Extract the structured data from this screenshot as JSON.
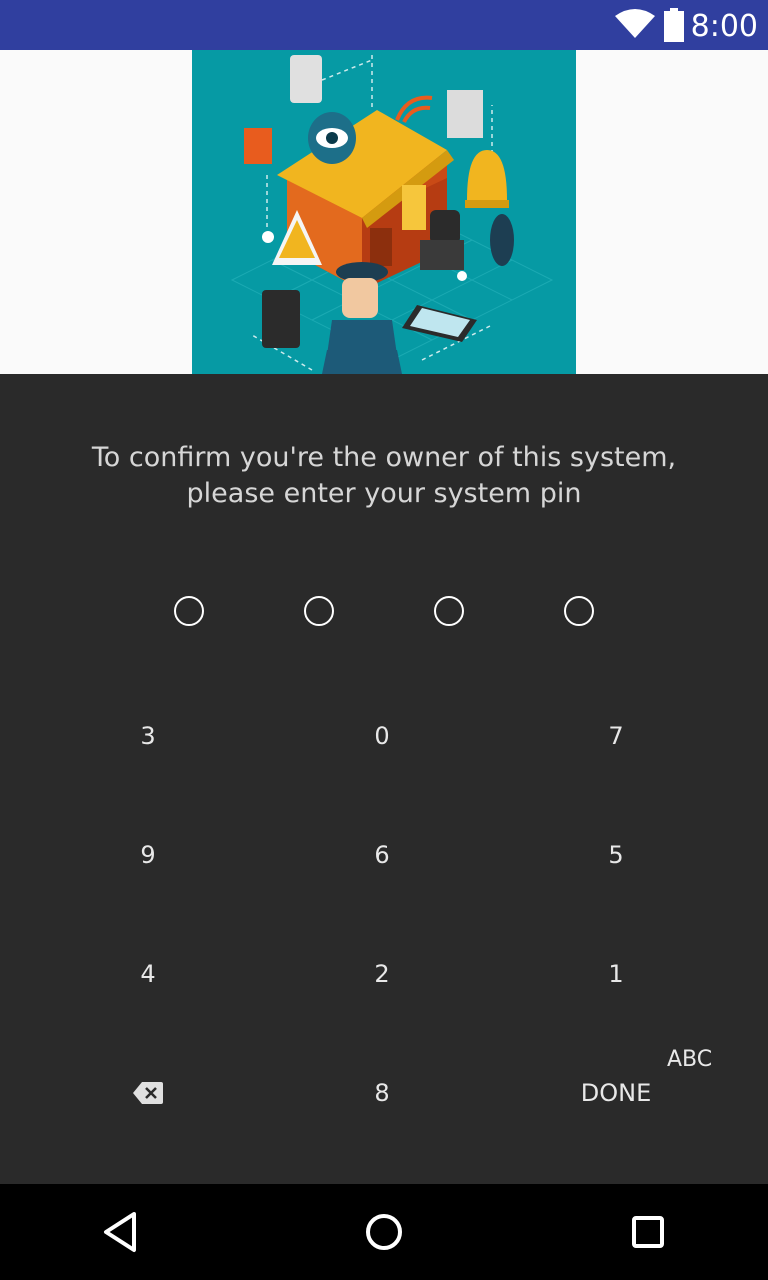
{
  "status_bar": {
    "time": "8:00",
    "background_color": "#303f9f",
    "icons": [
      "wifi-icon",
      "battery-icon"
    ]
  },
  "banner": {
    "illustration": "home-security-illustration",
    "background_color": "#069aa4"
  },
  "pin_entry": {
    "prompt_line1": "To confirm you're the owner of this system,",
    "prompt_line2": "please enter your system pin",
    "pin_length": 4,
    "digits_entered": 0
  },
  "keypad": {
    "rows": [
      [
        "3",
        "0",
        "7"
      ],
      [
        "9",
        "6",
        "5"
      ],
      [
        "4",
        "2",
        "1"
      ]
    ],
    "bottom_row": {
      "backspace_icon": "backspace-icon",
      "middle": "8",
      "done": "DONE"
    },
    "mode_toggle": "ABC"
  },
  "nav_bar": {
    "icons": [
      "back-icon",
      "home-icon",
      "recents-icon"
    ]
  }
}
